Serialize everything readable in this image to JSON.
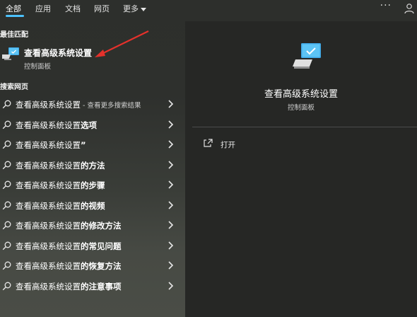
{
  "tabs": [
    {
      "label": "全部",
      "active": true
    },
    {
      "label": "应用"
    },
    {
      "label": "文档"
    },
    {
      "label": "网页"
    },
    {
      "label": "更多"
    }
  ],
  "header": {
    "more_dots": "···"
  },
  "best_match": {
    "section_label": "最佳匹配",
    "title": "查看高级系统设置",
    "subtitle": "控制面板"
  },
  "web": {
    "section_label": "搜索网页",
    "results": [
      {
        "prefix": "查看高级系统设置",
        "suffix": "",
        "hint": " - 查看更多搜索结果"
      },
      {
        "prefix": "查看高级系统设置",
        "suffix": "选项",
        "hint": ""
      },
      {
        "prefix": "查看高级系统设置",
        "suffix": "”",
        "hint": ""
      },
      {
        "prefix": "查看高级系统设置",
        "suffix": "的方法",
        "hint": ""
      },
      {
        "prefix": "查看高级系统设置",
        "suffix": "的步骤",
        "hint": ""
      },
      {
        "prefix": "查看高级系统设置",
        "suffix": "的视频",
        "hint": ""
      },
      {
        "prefix": "查看高级系统设置",
        "suffix": "的修改方法",
        "hint": ""
      },
      {
        "prefix": "查看高级系统设置",
        "suffix": "的常见问题",
        "hint": ""
      },
      {
        "prefix": "查看高级系统设置",
        "suffix": "的恢复方法",
        "hint": ""
      },
      {
        "prefix": "查看高级系统设置",
        "suffix": "的注意事项",
        "hint": ""
      }
    ]
  },
  "detail": {
    "title": "查看高级系统设置",
    "subtitle": "控制面板",
    "actions": [
      {
        "label": "打开"
      }
    ]
  },
  "colors": {
    "accent": "#4cc2ff",
    "annotation_arrow": "#e5312b",
    "detail_bg": "#262725"
  }
}
